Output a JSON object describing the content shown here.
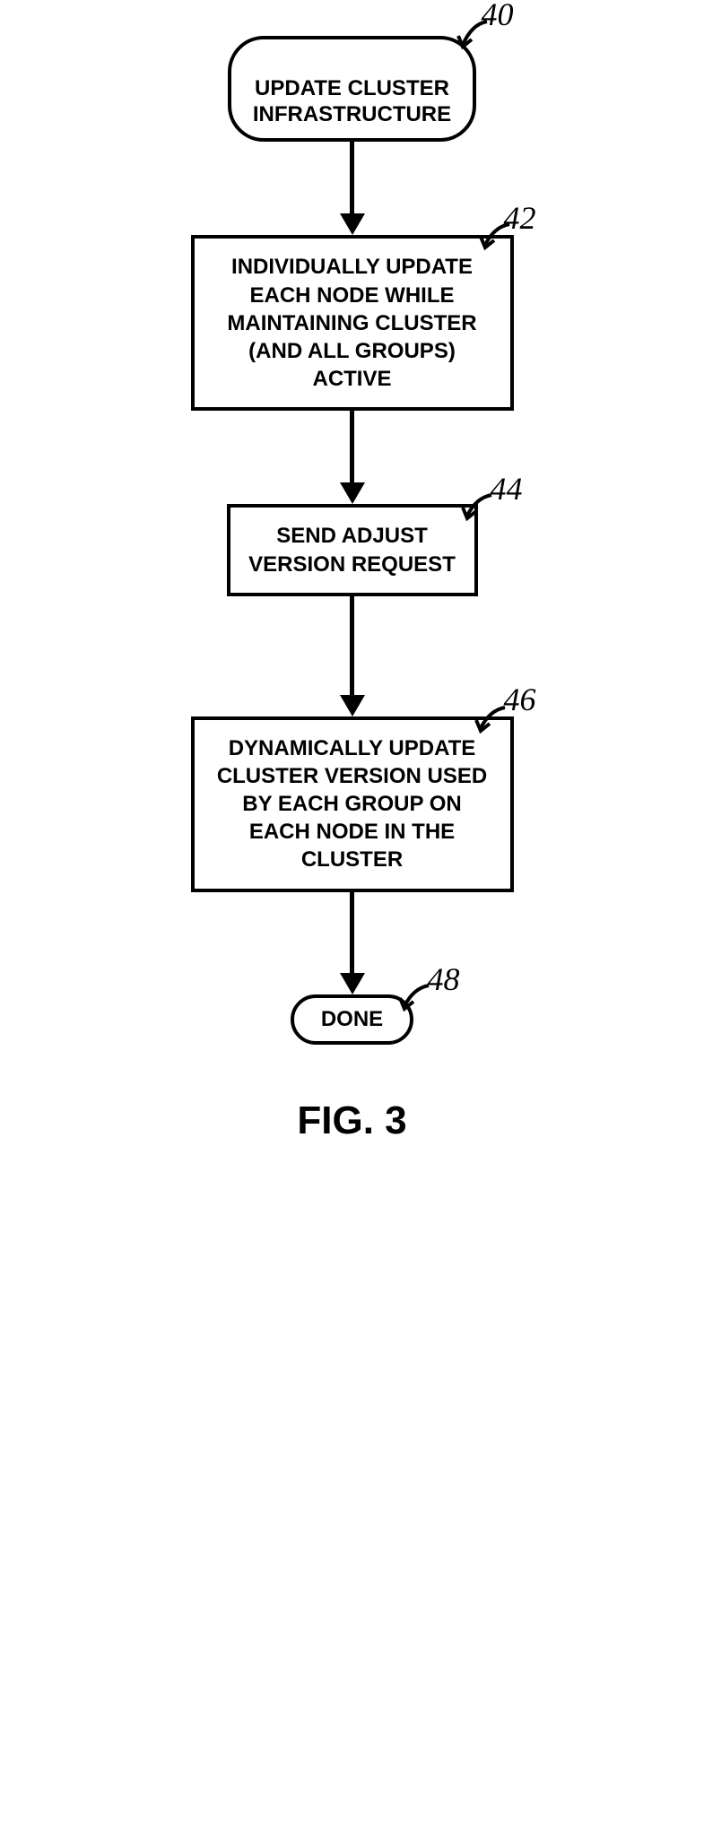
{
  "flowchart": {
    "nodes": {
      "start": {
        "label": "UPDATE CLUSTER\nINFRASTRUCTURE",
        "ref": "40"
      },
      "step1": {
        "label": "INDIVIDUALLY UPDATE EACH NODE WHILE MAINTAINING CLUSTER (AND ALL GROUPS) ACTIVE",
        "ref": "42"
      },
      "step2": {
        "label": "SEND ADJUST VERSION REQUEST",
        "ref": "44"
      },
      "step3": {
        "label": "DYNAMICALLY UPDATE CLUSTER VERSION USED BY EACH GROUP ON EACH NODE IN THE CLUSTER",
        "ref": "46"
      },
      "end": {
        "label": "DONE",
        "ref": "48"
      }
    },
    "caption": "FIG. 3"
  }
}
